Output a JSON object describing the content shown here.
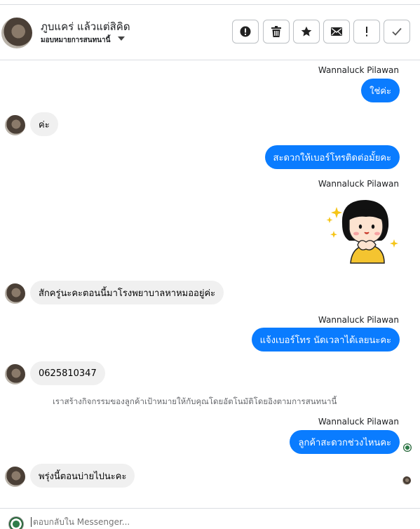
{
  "header": {
    "name": "ภูบแคร่ แล้วแต่สิคิด",
    "subtitle": "มอบหมายการสนทนานี้",
    "toolbar": [
      {
        "icon": "alert-circle-icon"
      },
      {
        "icon": "trash-icon"
      },
      {
        "icon": "star-icon"
      },
      {
        "icon": "envelope-icon"
      },
      {
        "icon": "exclamation-icon"
      },
      {
        "icon": "check-icon"
      }
    ]
  },
  "messages": {
    "sender_1": "Wannaluck Pilawan",
    "out_1": "ใช่ค่ะ",
    "in_1": "ค่ะ",
    "out_2": "สะดวกให้เบอร์โทรติดต่อมั้ยคะ",
    "sender_2": "Wannaluck Pilawan",
    "in_2": "สักครู่นะคะตอนนี้มาโรงพยาบาลหาหมออยู่ค่ะ",
    "sender_3": "Wannaluck Pilawan",
    "out_3": "แจ้งเบอร์โทร นัดเวลาได้เลยนะคะ",
    "in_3": "0625810347",
    "system": "เราสร้างกิจกรรมของลูกค้าเป้าหมายให้กับคุณโดยอัตโนมัติโดยอิงตามการสนทนานี้",
    "sender_4": "Wannaluck Pilawan",
    "out_4": "ลูกค้าสะดวกช่วงไหนคะ",
    "in_4": "พรุ่งนี้ตอนบ่ายไปนะคะ"
  },
  "composer": {
    "placeholder": "ตอบกลับใน Messenger..."
  },
  "colors": {
    "outgoing_bubble": "#0a7cff",
    "incoming_bubble": "#f0f0f0"
  }
}
